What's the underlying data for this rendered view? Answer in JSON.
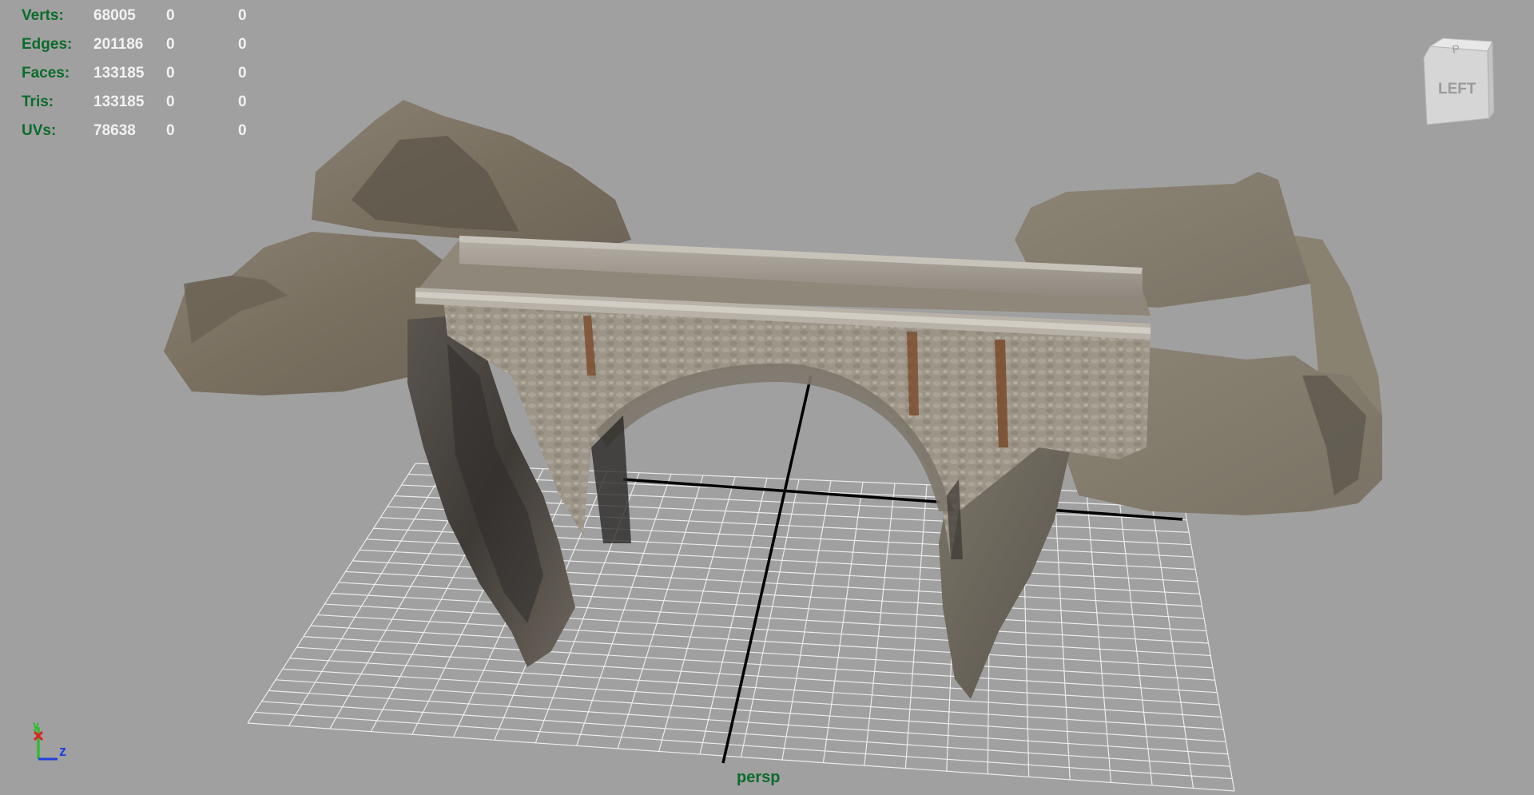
{
  "hud": {
    "rows": [
      {
        "label": "Verts:",
        "c1": "68005",
        "c2": "0",
        "c3": "0"
      },
      {
        "label": "Edges:",
        "c1": "201186",
        "c2": "0",
        "c3": "0"
      },
      {
        "label": "Faces:",
        "c1": "133185",
        "c2": "0",
        "c3": "0"
      },
      {
        "label": "Tris:",
        "c1": "133185",
        "c2": "0",
        "c3": "0"
      },
      {
        "label": "UVs:",
        "c1": "78638",
        "c2": "0",
        "c3": "0"
      }
    ]
  },
  "viewport": {
    "camera_name": "persp",
    "background_color": "#a0a0a0",
    "hud_label_color": "#0c6b2c",
    "hud_value_color": "#f2f2f2",
    "grid_color": "#ececec",
    "axis_line_color": "#000000"
  },
  "view_cube": {
    "face_label": "LEFT",
    "top_label": "P"
  },
  "axis_indicator": {
    "x_label": "x",
    "y_label": "y",
    "z_label": "z",
    "x_color": "#e02020",
    "y_color": "#20c020",
    "z_color": "#2040e0"
  }
}
